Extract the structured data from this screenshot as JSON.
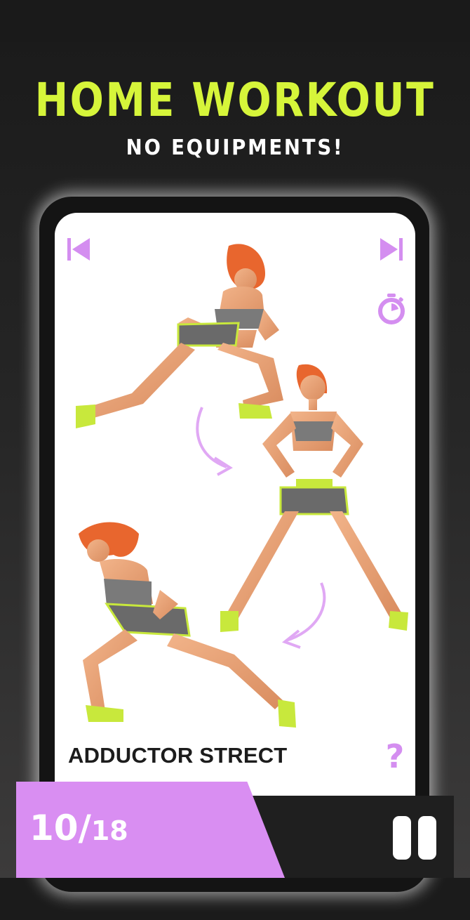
{
  "header": {
    "title": "HOME WORKOUT",
    "subtitle": "NO EQUIPMENTS!"
  },
  "exercise": {
    "name": "ADDUCTOR STRECT"
  },
  "progress": {
    "current": "10",
    "separator": "/",
    "total": "18"
  },
  "help": {
    "symbol": "?"
  },
  "icons": {
    "previous": "skip-previous-icon",
    "next": "skip-next-icon",
    "timer": "stopwatch-icon",
    "help": "question-mark-icon",
    "pause": "pause-icon"
  },
  "colors": {
    "title": "#d6f53a",
    "accent": "#d98ef2",
    "icon": "#d48ef0",
    "background": "#1a1a1a"
  }
}
